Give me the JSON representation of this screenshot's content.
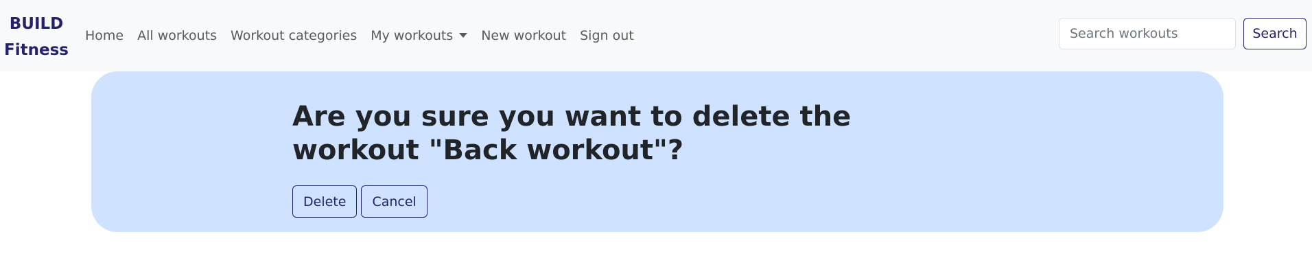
{
  "brand": {
    "line1": "BUILD",
    "line2": "Fitness"
  },
  "nav": {
    "home": "Home",
    "all_workouts": "All workouts",
    "workout_categories": "Workout categories",
    "my_workouts": "My workouts",
    "new_workout": "New workout",
    "sign_out": "Sign out"
  },
  "search": {
    "placeholder": "Search workouts",
    "button_label": "Search"
  },
  "confirm": {
    "heading": "Are you sure you want to delete the workout \"Back workout\"?",
    "delete_label": "Delete",
    "cancel_label": "Cancel"
  },
  "colors": {
    "brand": "#25226b",
    "navbar_bg": "#f8f9fa",
    "card_bg": "#cfe2ff",
    "nav_text": "#5a5a5a"
  }
}
